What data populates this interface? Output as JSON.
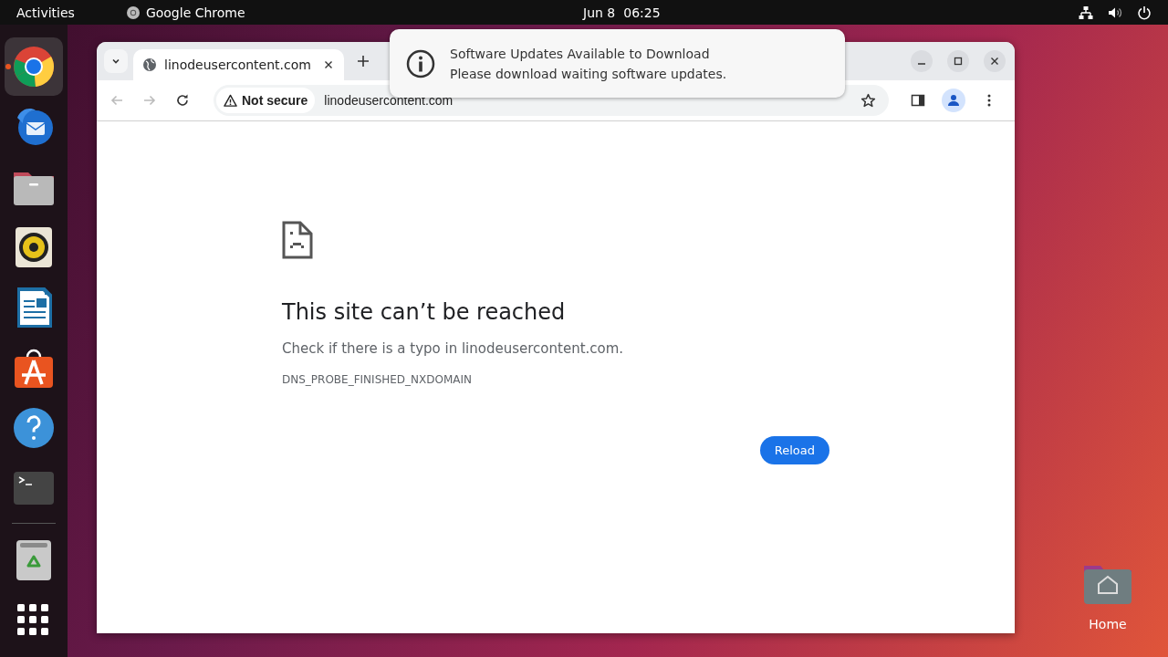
{
  "top_bar": {
    "activities": "Activities",
    "app_name": "Google Chrome",
    "date": "Jun 8",
    "time": "06:25"
  },
  "dock": {
    "items": [
      {
        "kind": "chrome",
        "selected": true,
        "running": true
      },
      {
        "kind": "mail",
        "selected": false,
        "running": false
      },
      {
        "kind": "files",
        "selected": false,
        "running": false
      },
      {
        "kind": "music",
        "selected": false,
        "running": false
      },
      {
        "kind": "writer",
        "selected": false,
        "running": false
      },
      {
        "kind": "store",
        "selected": false,
        "running": false
      },
      {
        "kind": "help",
        "selected": false,
        "running": false
      },
      {
        "kind": "terminal",
        "selected": false,
        "running": false
      },
      {
        "kind": "separator"
      },
      {
        "kind": "trash",
        "selected": false,
        "running": false
      },
      {
        "kind": "apps",
        "selected": false,
        "running": false
      }
    ]
  },
  "desktop_icons": [
    {
      "label": "Home"
    }
  ],
  "notification": {
    "title": "Software Updates Available to Download",
    "body": "Please download waiting software updates."
  },
  "browser": {
    "tabs": [
      {
        "title": "linodeusercontent.com",
        "selected": true
      }
    ],
    "security": "Not secure",
    "url": "linodeusercontent.com",
    "error": {
      "title": "This site can’t be reached",
      "message": "Check if there is a typo in linodeusercontent.com.",
      "code": "DNS_PROBE_FINISHED_NXDOMAIN",
      "button": "Reload"
    }
  }
}
